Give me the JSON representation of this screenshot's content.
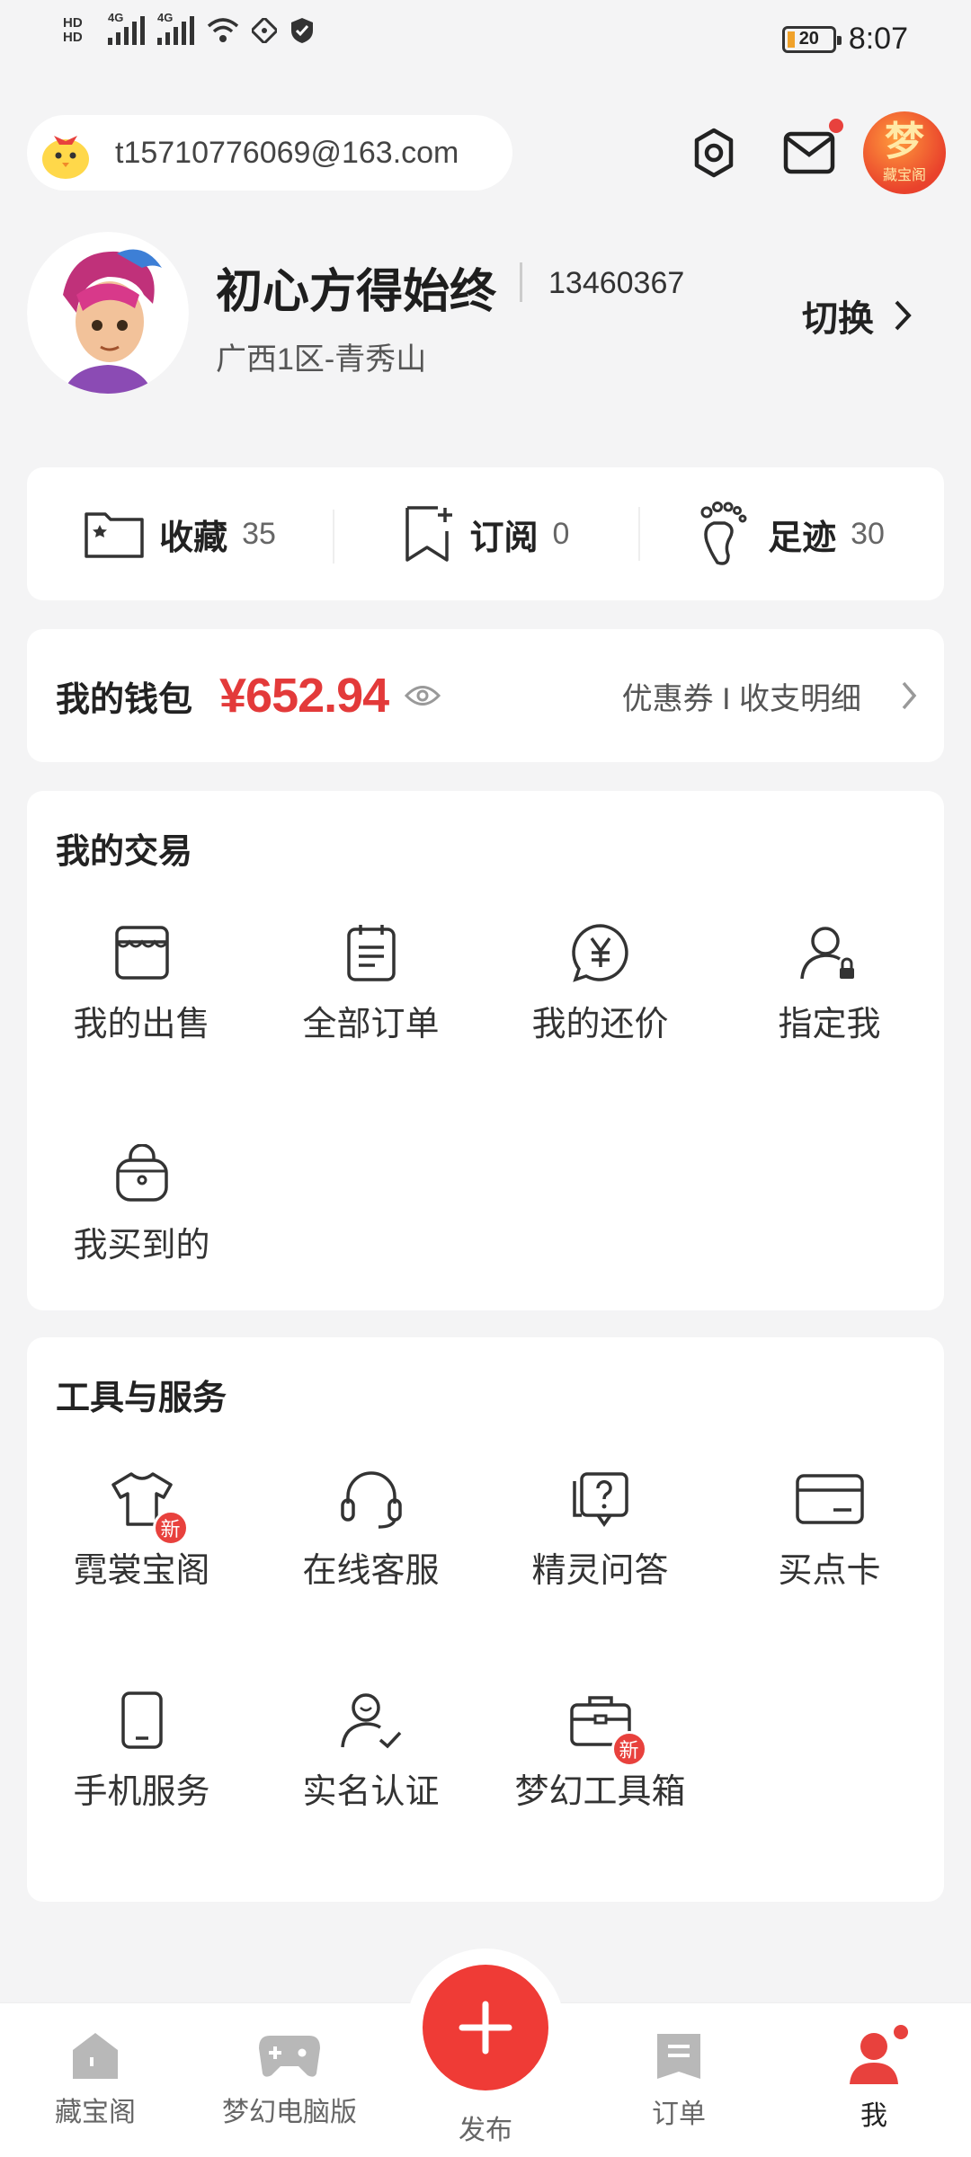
{
  "status_bar": {
    "hd1": "HD",
    "hd2": "HD",
    "net1": "4G",
    "net2": "4G",
    "battery": "20",
    "time": "8:07"
  },
  "account": {
    "email": "t15710776069@163.com"
  },
  "app_logo": {
    "big": "梦",
    "small": "藏宝阁"
  },
  "profile": {
    "name": "初心方得始终",
    "id": "13460367",
    "server": "广西1区-青秀山",
    "switch_label": "切换"
  },
  "counts": [
    {
      "label": "收藏",
      "value": "35",
      "icon": "folder-star-icon"
    },
    {
      "label": "订阅",
      "value": "0",
      "icon": "bookmark-plus-icon"
    },
    {
      "label": "足迹",
      "value": "30",
      "icon": "footprint-icon"
    }
  ],
  "wallet": {
    "title": "我的钱包",
    "amount": "¥652.94",
    "links": "优惠券 I 收支明细"
  },
  "trade": {
    "title": "我的交易",
    "items": [
      {
        "label": "我的出售",
        "icon": "shop-icon"
      },
      {
        "label": "全部订单",
        "icon": "order-list-icon"
      },
      {
        "label": "我的还价",
        "icon": "yuan-bubble-icon"
      },
      {
        "label": "指定我",
        "icon": "user-lock-icon"
      },
      {
        "label": "我买到的",
        "icon": "bag-icon"
      }
    ]
  },
  "tools": {
    "title": "工具与服务",
    "badge": "新",
    "items": [
      {
        "label": "霓裳宝阁",
        "icon": "tshirt-icon",
        "badge": true
      },
      {
        "label": "在线客服",
        "icon": "headset-icon"
      },
      {
        "label": "精灵问答",
        "icon": "question-icon"
      },
      {
        "label": "买点卡",
        "icon": "card-icon"
      },
      {
        "label": "手机服务",
        "icon": "phone-icon"
      },
      {
        "label": "实名认证",
        "icon": "user-check-icon"
      },
      {
        "label": "梦幻工具箱",
        "icon": "toolbox-icon",
        "badge": true
      }
    ]
  },
  "bottom_nav": {
    "items": [
      {
        "label": "藏宝阁",
        "icon": "home-icon"
      },
      {
        "label": "梦幻电脑版",
        "icon": "gamepad-icon"
      },
      {
        "label": "订单",
        "icon": "order-icon"
      },
      {
        "label": "我",
        "icon": "user-icon"
      }
    ],
    "publish": "发布"
  },
  "colors": {
    "accent": "#ef3b36",
    "price": "#e33a3a",
    "background": "#f4f4f5"
  }
}
